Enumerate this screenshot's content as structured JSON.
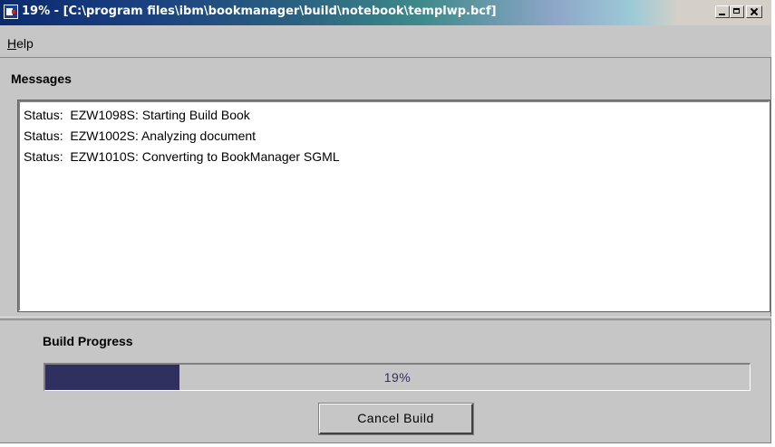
{
  "window": {
    "title": "19% - [C:\\program files\\ibm\\bookmanager\\build\\notebook\\templwp.bcf]",
    "app_icon": "bookmanager-app-icon"
  },
  "menu": {
    "help_mnemonic": "H",
    "help_rest": "elp"
  },
  "messages": {
    "heading": "Messages",
    "lines": [
      "Status:  EZW1098S: Starting Build Book",
      "Status:  EZW1002S: Analyzing document",
      "Status:  EZW1010S: Converting to BookManager SGML"
    ]
  },
  "progress": {
    "heading": "Build Progress",
    "percent_label": "19%",
    "fraction": 0.19,
    "fill_color": "#303060"
  },
  "actions": {
    "cancel_label": "Cancel Build"
  }
}
